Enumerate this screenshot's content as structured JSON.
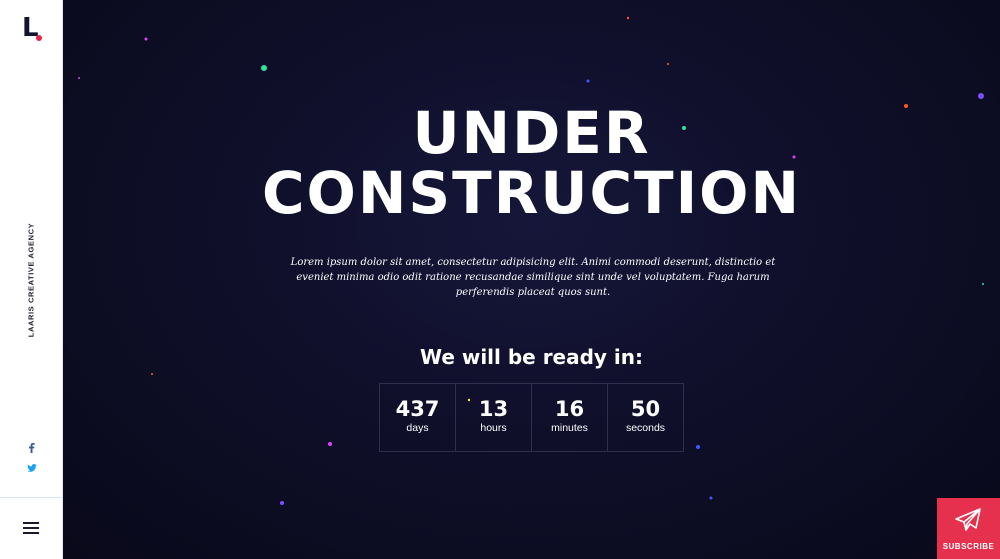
{
  "brand": {
    "logo_text": "L",
    "accent": "#e6274a",
    "tagline": "LAARIS CREATIVE AGENCY"
  },
  "sidebar": {
    "social": [
      {
        "icon": "facebook-icon",
        "glyph": "f",
        "color": "#3b5998"
      },
      {
        "icon": "twitter-icon",
        "glyph": "🐦",
        "color": "#1da1f2"
      }
    ],
    "menu_icon": "hamburger-icon"
  },
  "hero": {
    "line1": "UNDER",
    "line2": "CONSTRUCTION",
    "description": "Lorem ipsum dolor sit amet, consectetur adipisicing elit. Animi commodi deserunt, distinctio et eveniet minima odio odit ratione recusandae similique sint unde vel voluptatem. Fuga harum perferendis placeat quos sunt."
  },
  "countdown": {
    "heading": "We will be ready in:",
    "items": [
      {
        "value": "437",
        "unit": "days"
      },
      {
        "value": "13",
        "unit": "hours"
      },
      {
        "value": "16",
        "unit": "minutes"
      },
      {
        "value": "50",
        "unit": "seconds"
      }
    ]
  },
  "subscribe": {
    "label": "SUBSCRIBE",
    "icon": "paper-plane-icon",
    "color": "#e5304e"
  }
}
